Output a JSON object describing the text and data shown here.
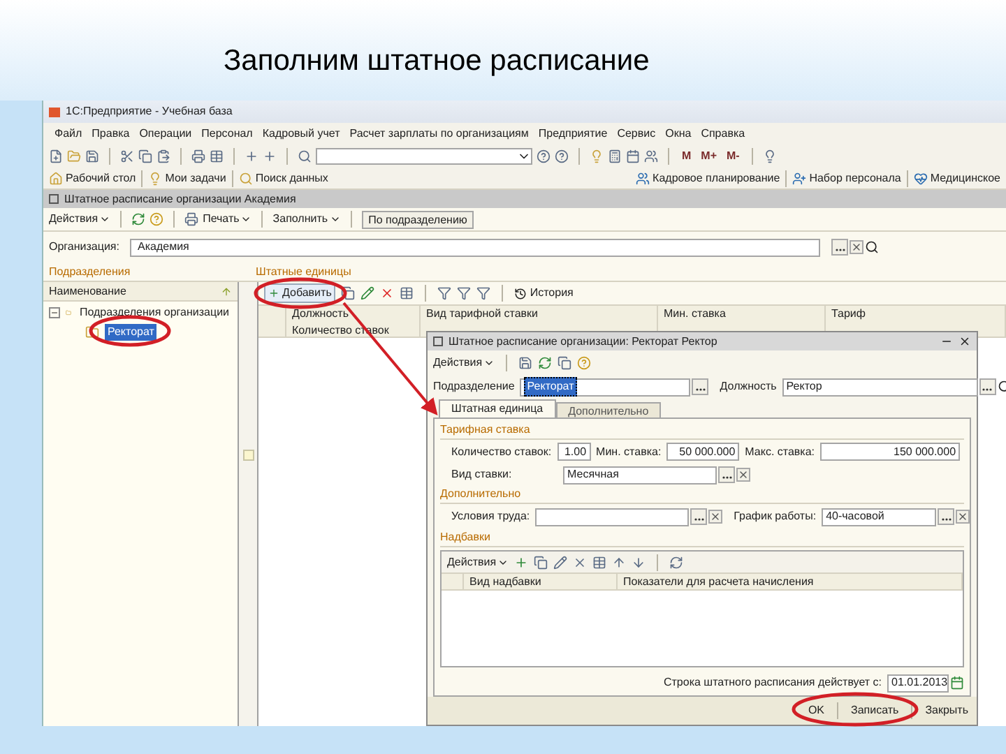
{
  "slide": {
    "title": "Заполним штатное расписание"
  },
  "app": {
    "title": "1С:Предприятие - Учебная база",
    "menu": [
      "Файл",
      "Правка",
      "Операции",
      "Персонал",
      "Кадровый учет",
      "Расчет зарплаты по организациям",
      "Предприятие",
      "Сервис",
      "Окна",
      "Справка"
    ],
    "memory_buttons": [
      "М",
      "М+",
      "М-"
    ],
    "panel": [
      "Рабочий стол",
      "Мои задачи",
      "Поиск данных"
    ],
    "panel_right": [
      "Кадровое планирование",
      "Набор персонала",
      "Медицинское"
    ]
  },
  "document": {
    "title": "Штатное расписание организации Академия",
    "toolbar": [
      {
        "kind": "menu",
        "label": "Действия"
      },
      {
        "kind": "menu",
        "label": "Печать"
      },
      {
        "kind": "menu",
        "label": "Заполнить"
      },
      {
        "kind": "button",
        "label": "По подразделению"
      }
    ],
    "organization": {
      "label": "Организация:",
      "value": "Академия"
    },
    "departments": {
      "heading": "Подразделения",
      "column": "Наименование",
      "tree": [
        {
          "label": "Подразделения организации",
          "expanded": true,
          "selected": false,
          "children": [
            {
              "label": "Ректорат",
              "selected": true
            }
          ]
        }
      ]
    },
    "positions": {
      "heading": "Штатные единицы",
      "add_button": "Добавить",
      "history_button": "История",
      "columns": [
        {
          "top": "Должность",
          "bottom": "Количество ставок"
        },
        {
          "top": "Вид тарифной ставки"
        },
        {
          "top": "Мин. ставка"
        },
        {
          "top": "Тариф"
        }
      ]
    }
  },
  "dialog": {
    "title": "Штатное расписание организации: Ректорат Ректор",
    "actions": "Действия",
    "department": {
      "label": "Подразделение",
      "value": "Ректорат"
    },
    "position": {
      "label": "Должность",
      "value": "Ректор"
    },
    "tabs": [
      {
        "label": "Штатная единица",
        "selected": true
      },
      {
        "label": "Дополнительно",
        "selected": false
      }
    ],
    "rate_group": {
      "title": "Тарифная ставка",
      "count": {
        "label": "Количество ставок:",
        "value": "1.00"
      },
      "min": {
        "label": "Мин. ставка:",
        "value": "50 000.000"
      },
      "max": {
        "label": "Макс. ставка:",
        "value": "150 000.000"
      },
      "kind": {
        "label": "Вид ставки:",
        "value": "Месячная"
      }
    },
    "extra_group": {
      "title": "Дополнительно",
      "conditions": {
        "label": "Условия труда:"
      },
      "schedule": {
        "label": "График работы:",
        "value": "40-часовой"
      }
    },
    "bonus_group": {
      "title": "Надбавки",
      "actions": "Действия",
      "columns": [
        "Вид надбавки",
        "Показатели для расчета начисления"
      ]
    },
    "valid_from": {
      "label": "Строка штатного расписания действует с:",
      "value": "01.01.2013"
    },
    "buttons": [
      "OK",
      "Записать",
      "Закрыть"
    ]
  }
}
